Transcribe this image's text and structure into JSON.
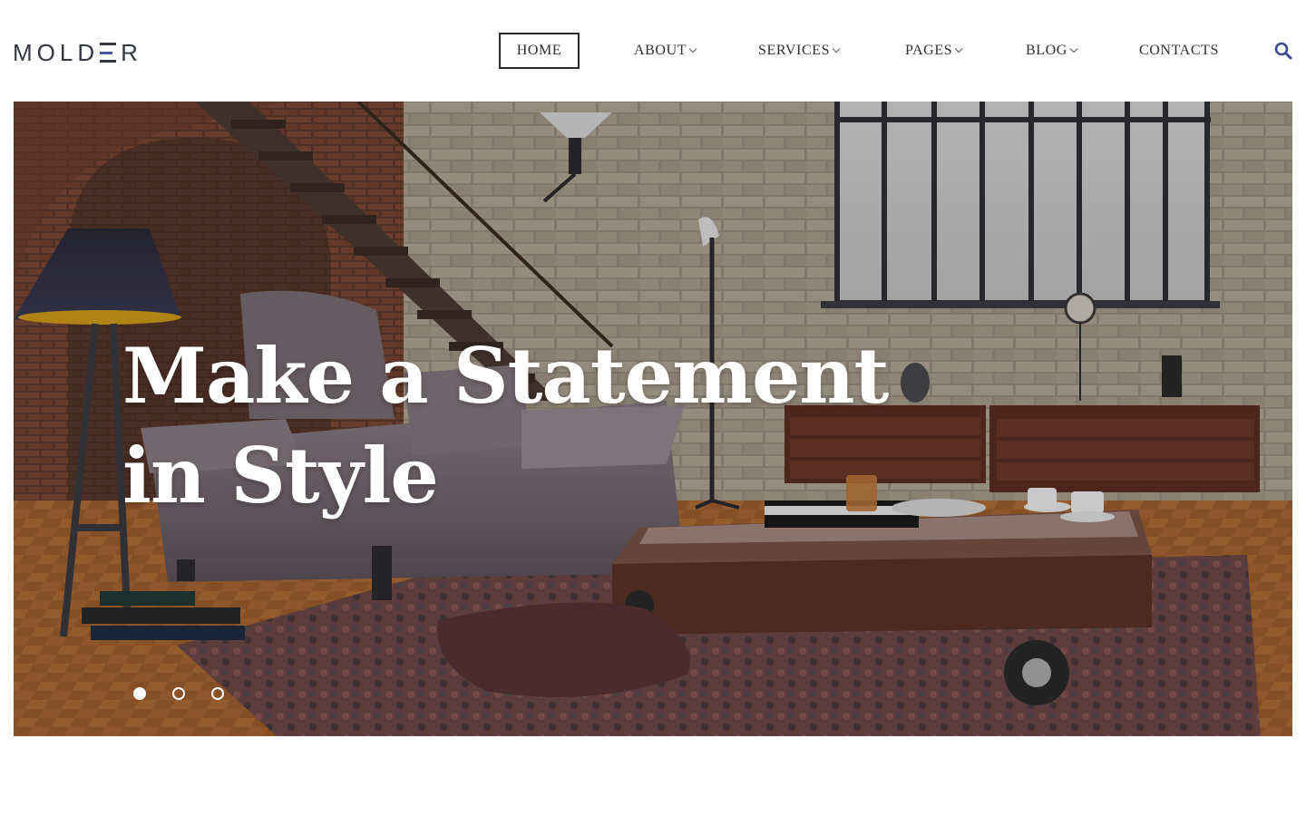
{
  "brand": {
    "name_prefix": "MOLD",
    "name_accent": "E",
    "name_suffix": "R",
    "accent_color": "#4a58a8"
  },
  "nav": {
    "items": [
      {
        "label": "HOME",
        "active": true,
        "dropdown": false
      },
      {
        "label": "ABOUT",
        "active": false,
        "dropdown": true
      },
      {
        "label": "SERVICES",
        "active": false,
        "dropdown": true
      },
      {
        "label": "PAGES",
        "active": false,
        "dropdown": true
      },
      {
        "label": "BLOG",
        "active": false,
        "dropdown": true
      },
      {
        "label": "CONTACTS",
        "active": false,
        "dropdown": false
      }
    ],
    "search_icon": "search-icon",
    "search_color": "#3a4a8c"
  },
  "hero": {
    "title_line1": "Make a Statement",
    "title_line2": "in Style",
    "image": "loft-living-room-photo",
    "slides_total": 3,
    "slide_active": 1
  }
}
